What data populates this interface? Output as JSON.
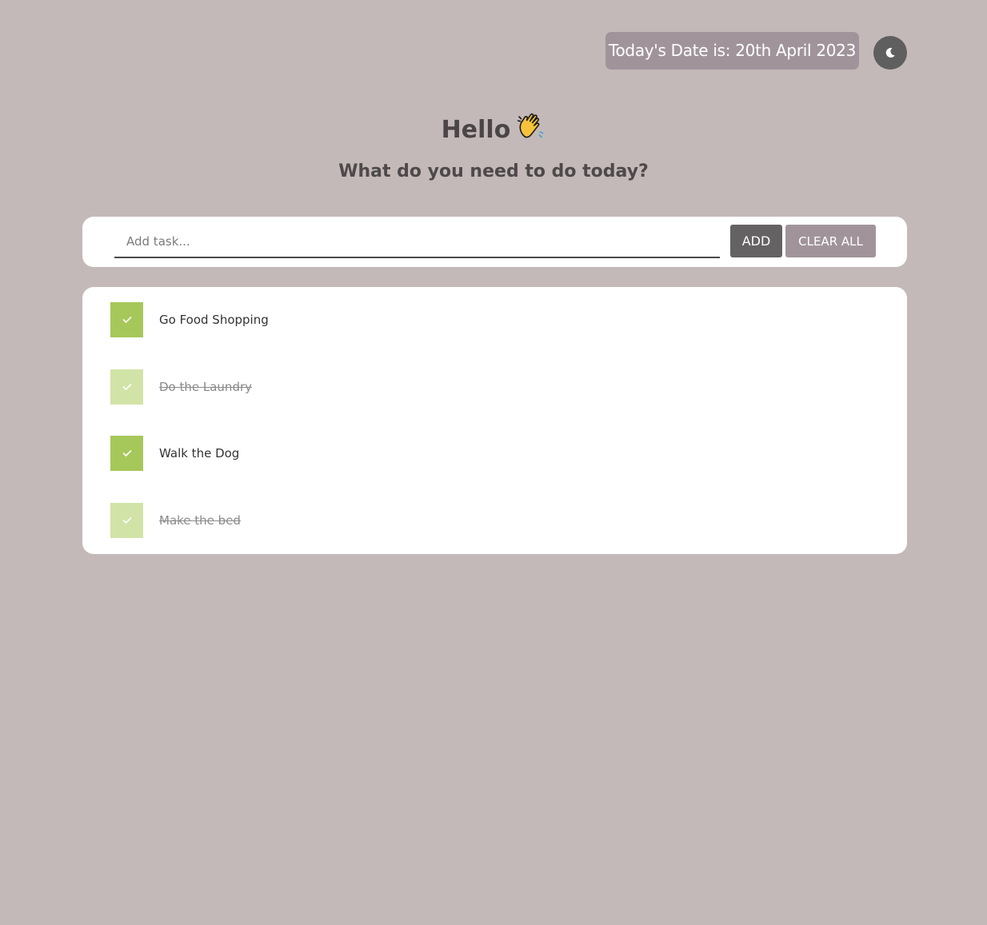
{
  "header": {
    "date_text": "Today's Date is: 20th April 2023",
    "theme_toggle_icon": "moon-icon"
  },
  "greeting": {
    "title": "Hello",
    "emoji_icon": "waving-hand-icon",
    "subtitle": "What do you need to do today?"
  },
  "add_task": {
    "placeholder": "Add task...",
    "value": "",
    "add_label": "ADD",
    "clear_label": "CLEAR ALL"
  },
  "tasks": [
    {
      "label": "Go Food Shopping",
      "completed": false
    },
    {
      "label": "Do the Laundry",
      "completed": true
    },
    {
      "label": "Walk the Dog",
      "completed": false
    },
    {
      "label": "Make the bed",
      "completed": true
    }
  ],
  "colors": {
    "background": "#c3b9b8",
    "pill": "#a0949a",
    "checkbox_active": "#a6c85a",
    "checkbox_done": "#d2e3a8",
    "add_button": "#646262"
  }
}
